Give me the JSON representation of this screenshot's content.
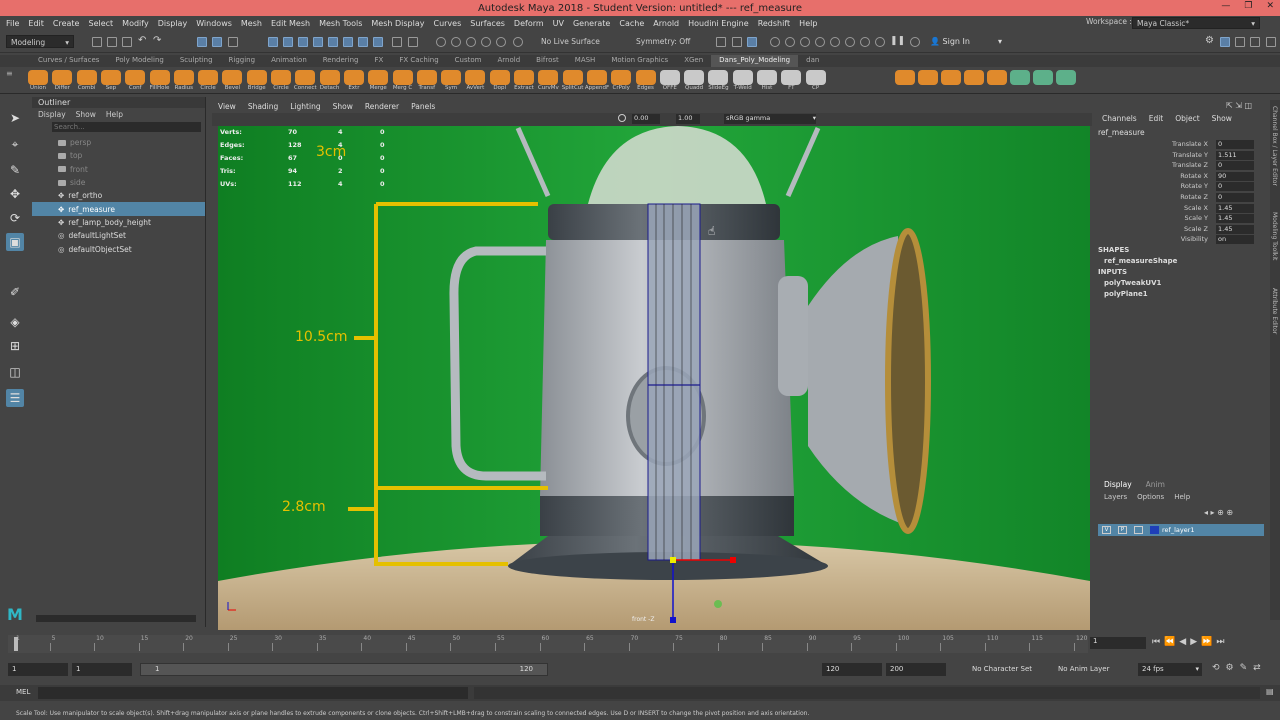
{
  "window": {
    "title": "Autodesk Maya 2018 - Student Version: untitled*   ---   ref_measure",
    "controls": [
      "—",
      "❐",
      "✕"
    ]
  },
  "menubar": [
    "File",
    "Edit",
    "Create",
    "Select",
    "Modify",
    "Display",
    "Windows",
    "Mesh",
    "Edit Mesh",
    "Mesh Tools",
    "Mesh Display",
    "Curves",
    "Surfaces",
    "Deform",
    "UV",
    "Generate",
    "Cache",
    "Arnold",
    "Houdini Engine",
    "Redshift",
    "Help"
  ],
  "workspace": {
    "label": "Workspace :",
    "value": "Maya Classic*"
  },
  "toolbar": {
    "mode": "Modeling",
    "live_surface": "No Live Surface",
    "symmetry": "Symmetry: Off",
    "sign_in": "Sign In"
  },
  "shelf_tabs": [
    "Curves / Surfaces",
    "Poly Modeling",
    "Sculpting",
    "Rigging",
    "Animation",
    "Rendering",
    "FX",
    "FX Caching",
    "Custom",
    "Arnold",
    "Bifrost",
    "MASH",
    "Motion Graphics",
    "XGen",
    "Dans_Poly_Modeling",
    "dan"
  ],
  "shelf_buttons": [
    "Union",
    "Differ",
    "Combi",
    "Sep",
    "Conf",
    "FillHole",
    "Radius",
    "Circle",
    "Bevel",
    "Bridge",
    "Circle",
    "Connect",
    "Detach",
    "Extr",
    "Merge",
    "Merg C",
    "Transf",
    "Sym",
    "AvVert",
    "Dopl",
    "Extract",
    "CurvMv",
    "SplitCut",
    "AppendF",
    "CrPoly",
    "Edges",
    "OFFE",
    "Quadd",
    "SlideEg",
    "T-Weld",
    "Hist",
    "FT",
    "CP"
  ],
  "outliner": {
    "title": "Outliner",
    "menu": [
      "Display",
      "Show",
      "Help"
    ],
    "search_placeholder": "Search...",
    "items": [
      {
        "name": "persp",
        "dim": true
      },
      {
        "name": "top",
        "dim": true
      },
      {
        "name": "front",
        "dim": true
      },
      {
        "name": "side",
        "dim": true
      },
      {
        "name": "ref_ortho",
        "dim": false
      },
      {
        "name": "ref_measure",
        "dim": false,
        "selected": true
      },
      {
        "name": "ref_lamp_body_height",
        "dim": false
      },
      {
        "name": "defaultLightSet",
        "dim": false
      },
      {
        "name": "defaultObjectSet",
        "dim": false
      }
    ]
  },
  "viewport": {
    "menu": [
      "View",
      "Shading",
      "Lighting",
      "Show",
      "Renderer",
      "Panels"
    ],
    "exposure": "0.00",
    "gamma": "1.00",
    "colorspace": "sRGB gamma",
    "camera": "front -Z",
    "hud": [
      [
        "Verts:",
        "70",
        "4",
        "0"
      ],
      [
        "Edges:",
        "128",
        "4",
        "0"
      ],
      [
        "Faces:",
        "67",
        "0",
        "0"
      ],
      [
        "Tris:",
        "94",
        "2",
        "0"
      ],
      [
        "UVs:",
        "112",
        "4",
        "0"
      ]
    ],
    "measures": [
      "3cm",
      "10.5cm",
      "2.8cm"
    ]
  },
  "channelbox": {
    "menu": [
      "Channels",
      "Edit",
      "Object",
      "Show"
    ],
    "object": "ref_measure",
    "attrs": [
      [
        "Translate X",
        "0"
      ],
      [
        "Translate Y",
        "1.511"
      ],
      [
        "Translate Z",
        "0"
      ],
      [
        "Rotate X",
        "90"
      ],
      [
        "Rotate Y",
        "0"
      ],
      [
        "Rotate Z",
        "0"
      ],
      [
        "Scale X",
        "1.45"
      ],
      [
        "Scale Y",
        "1.45"
      ],
      [
        "Scale Z",
        "1.45"
      ],
      [
        "Visibility",
        "on"
      ]
    ],
    "shapes_label": "SHAPES",
    "shape": "ref_measureShape",
    "inputs_label": "INPUTS",
    "inputs": [
      "polyTweakUV1",
      "polyPlane1"
    ]
  },
  "side_tabs": [
    "Channel Box / Layer Editor",
    "Modeling Toolkit",
    "Attribute Editor"
  ],
  "layers": {
    "tabs": [
      "Display",
      "Anim"
    ],
    "menu": [
      "Layers",
      "Options",
      "Help"
    ],
    "layer": {
      "v": "V",
      "p": "P",
      "name": "ref_layer1"
    }
  },
  "timeline": {
    "ticks": [
      "1",
      "5",
      "10",
      "15",
      "20",
      "25",
      "30",
      "35",
      "40",
      "45",
      "50",
      "55",
      "60",
      "65",
      "70",
      "75",
      "80",
      "85",
      "90",
      "95",
      "100",
      "105",
      "110",
      "115",
      "120"
    ],
    "current": "1"
  },
  "range": {
    "start": "1",
    "inner_start": "1",
    "slider_start": "1",
    "slider_end": "120",
    "end": "120",
    "anim_end": "200",
    "char_set": "No Character Set",
    "anim_layer": "No Anim Layer",
    "fps": "24 fps"
  },
  "mel": {
    "label": "MEL"
  },
  "help_line": "Scale Tool: Use manipulator to scale object(s). Shift+drag manipulator axis or plane handles to extrude components or clone objects. Ctrl+Shift+LMB+drag to constrain scaling to connected edges. Use D or INSERT to change the pivot position and axis orientation.",
  "colors": {
    "title_bar": "#e76f6b",
    "selection": "#5285a6",
    "green_screen": "#1c9a2b",
    "measure": "#e5c000"
  }
}
